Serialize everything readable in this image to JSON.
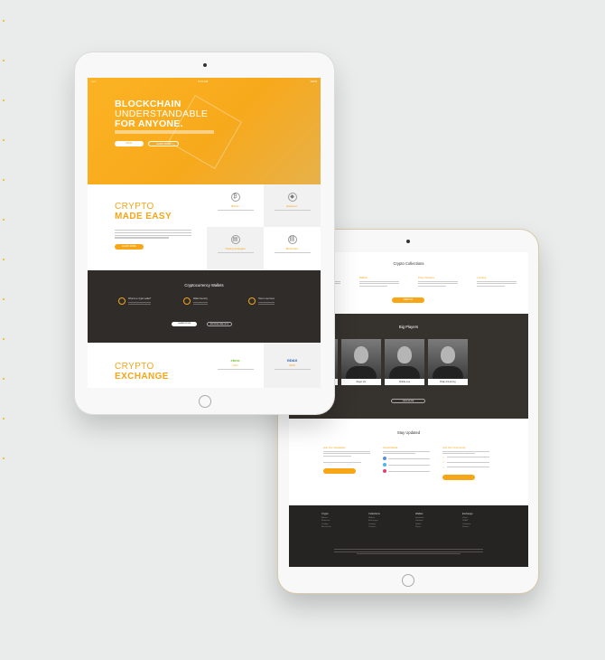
{
  "front": {
    "statusbar": {
      "left": "•••••",
      "time": "9:41 AM",
      "right": "100%"
    },
    "hero": {
      "line1": "BLOCKCHAIN",
      "line2": "UNDERSTANDABLE",
      "line3": "FOR ANYONE.",
      "btn_primary": "READ",
      "btn_secondary": "LEARN MORE"
    },
    "made_easy": {
      "title_thin": "CRYPTO",
      "title_bold": "MADE EASY",
      "cta": "LEARN MORE",
      "features": [
        {
          "label": "Bitcoin",
          "icon": "bitcoin-icon",
          "glyph": "₿"
        },
        {
          "label": "Ethereum",
          "icon": "ethereum-icon",
          "glyph": "◆"
        },
        {
          "label": "Trading Strategies",
          "icon": "chart-icon",
          "glyph": "▤"
        },
        {
          "label": "Blockchain",
          "icon": "blockchain-icon",
          "glyph": "⛓"
        }
      ]
    },
    "wallets": {
      "title": "Cryptocurrency Wallets",
      "items": [
        "What is a crypto wallet?",
        "Wallet Security",
        "How to use them"
      ],
      "btn_a": "LEARN MORE",
      "btn_b": "BROWSE WALLETS"
    },
    "exchange": {
      "title_thin": "CRYPTO",
      "title_bold": "EXCHANGE",
      "tiles": [
        {
          "logo": "etoro",
          "label": "eToro",
          "color": "#6cbf2c"
        },
        {
          "logo": "GDAX",
          "label": "GDAX",
          "color": "#1e5aa8"
        }
      ]
    }
  },
  "back": {
    "collections": {
      "title": "Crypto Collections",
      "columns": [
        "Trading Platforms",
        "Wallets",
        "Price Trackers",
        "Lending"
      ],
      "cta": "VIEW ALL"
    },
    "players": {
      "title": "Big Players",
      "names": [
        "Vitalik Buterin",
        "Roger Ver",
        "Charlie Lee",
        "Brian Armstrong"
      ],
      "cta": "VIEW MORE"
    },
    "updated": {
      "title": "Stay Updated",
      "columns": [
        "Join Our Newsletter",
        "Social Media",
        "Join Our Community"
      ]
    },
    "footer": {
      "columns": [
        {
          "head": "Crypto",
          "links": [
            "Bitcoin",
            "Ethereum",
            "Trading",
            "Blockchain"
          ]
        },
        {
          "head": "Collections",
          "links": [
            "Wallets",
            "Exchanges",
            "Lending",
            "Trackers"
          ]
        },
        {
          "head": "Wallets",
          "links": [
            "Hardware",
            "Software",
            "Mobile",
            "Paper"
          ]
        },
        {
          "head": "Exchange",
          "links": [
            "eToro",
            "GDAX",
            "Coinbase",
            "Kraken"
          ]
        }
      ]
    }
  },
  "colors": {
    "accent": "#f6a616",
    "dark": "#2f2c29",
    "background": "#e9eceb"
  }
}
